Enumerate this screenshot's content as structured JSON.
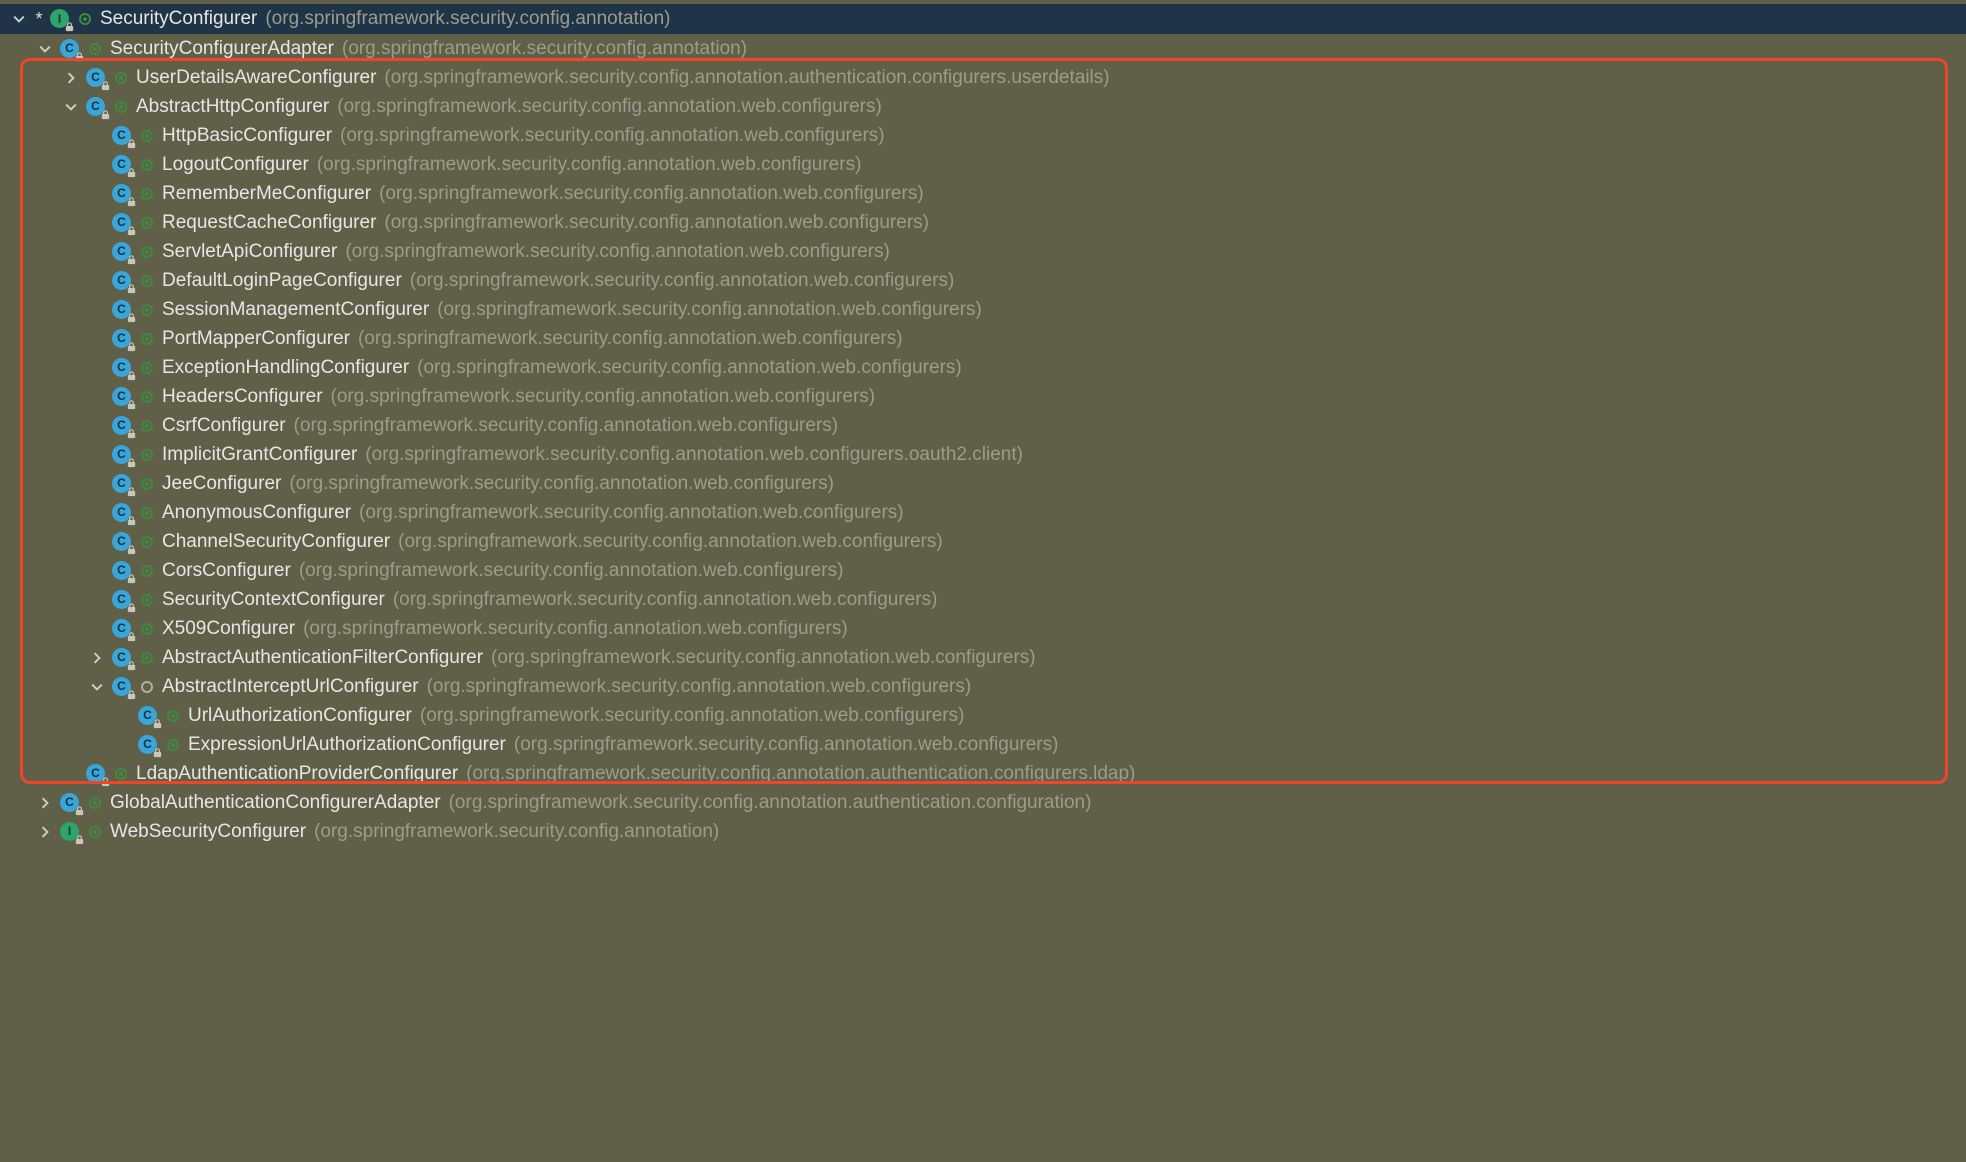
{
  "pkg_annotation": "(org.springframework.security.config.annotation)",
  "pkg_web_conf": "(org.springframework.security.config.annotation.web.configurers)",
  "pkg_userdetails": "(org.springframework.security.config.annotation.authentication.configurers.userdetails)",
  "pkg_oauth2": "(org.springframework.security.config.annotation.web.configurers.oauth2.client)",
  "pkg_ldap": "(org.springframework.security.config.annotation.authentication.configurers.ldap)",
  "pkg_auth_conf": "(org.springframework.security.config.annotation.authentication.configuration)",
  "nodes": [
    {
      "indent": 0,
      "arrow": "down",
      "star": true,
      "icon": "interface",
      "vis": "public",
      "name": "SecurityConfigurer",
      "pkgref": "pkg_annotation",
      "root": true
    },
    {
      "indent": 1,
      "arrow": "down",
      "star": false,
      "icon": "class",
      "vis": "public",
      "name": "SecurityConfigurerAdapter",
      "pkgref": "pkg_annotation"
    },
    {
      "indent": 2,
      "arrow": "right",
      "star": false,
      "icon": "class",
      "vis": "public",
      "name": "UserDetailsAwareConfigurer",
      "pkgref": "pkg_userdetails"
    },
    {
      "indent": 2,
      "arrow": "down",
      "star": false,
      "icon": "class",
      "vis": "public",
      "name": "AbstractHttpConfigurer",
      "pkgref": "pkg_web_conf"
    },
    {
      "indent": 3,
      "arrow": "none",
      "star": false,
      "icon": "class",
      "vis": "public",
      "name": "HttpBasicConfigurer",
      "pkgref": "pkg_web_conf"
    },
    {
      "indent": 3,
      "arrow": "none",
      "star": false,
      "icon": "class",
      "vis": "public",
      "name": "LogoutConfigurer",
      "pkgref": "pkg_web_conf"
    },
    {
      "indent": 3,
      "arrow": "none",
      "star": false,
      "icon": "class",
      "vis": "public",
      "name": "RememberMeConfigurer",
      "pkgref": "pkg_web_conf"
    },
    {
      "indent": 3,
      "arrow": "none",
      "star": false,
      "icon": "class",
      "vis": "public",
      "name": "RequestCacheConfigurer",
      "pkgref": "pkg_web_conf"
    },
    {
      "indent": 3,
      "arrow": "none",
      "star": false,
      "icon": "class",
      "vis": "public",
      "name": "ServletApiConfigurer",
      "pkgref": "pkg_web_conf"
    },
    {
      "indent": 3,
      "arrow": "none",
      "star": false,
      "icon": "class",
      "vis": "public",
      "name": "DefaultLoginPageConfigurer",
      "pkgref": "pkg_web_conf"
    },
    {
      "indent": 3,
      "arrow": "none",
      "star": false,
      "icon": "class",
      "vis": "public",
      "name": "SessionManagementConfigurer",
      "pkgref": "pkg_web_conf"
    },
    {
      "indent": 3,
      "arrow": "none",
      "star": false,
      "icon": "class",
      "vis": "public",
      "name": "PortMapperConfigurer",
      "pkgref": "pkg_web_conf"
    },
    {
      "indent": 3,
      "arrow": "none",
      "star": false,
      "icon": "class",
      "vis": "public",
      "name": "ExceptionHandlingConfigurer",
      "pkgref": "pkg_web_conf"
    },
    {
      "indent": 3,
      "arrow": "none",
      "star": false,
      "icon": "class",
      "vis": "public",
      "name": "HeadersConfigurer",
      "pkgref": "pkg_web_conf"
    },
    {
      "indent": 3,
      "arrow": "none",
      "star": false,
      "icon": "class",
      "vis": "public",
      "name": "CsrfConfigurer",
      "pkgref": "pkg_web_conf"
    },
    {
      "indent": 3,
      "arrow": "none",
      "star": false,
      "icon": "class",
      "vis": "public",
      "name": "ImplicitGrantConfigurer",
      "pkgref": "pkg_oauth2"
    },
    {
      "indent": 3,
      "arrow": "none",
      "star": false,
      "icon": "class",
      "vis": "public",
      "name": "JeeConfigurer",
      "pkgref": "pkg_web_conf"
    },
    {
      "indent": 3,
      "arrow": "none",
      "star": false,
      "icon": "class",
      "vis": "public",
      "name": "AnonymousConfigurer",
      "pkgref": "pkg_web_conf"
    },
    {
      "indent": 3,
      "arrow": "none",
      "star": false,
      "icon": "class",
      "vis": "public",
      "name": "ChannelSecurityConfigurer",
      "pkgref": "pkg_web_conf"
    },
    {
      "indent": 3,
      "arrow": "none",
      "star": false,
      "icon": "class",
      "vis": "public",
      "name": "CorsConfigurer",
      "pkgref": "pkg_web_conf"
    },
    {
      "indent": 3,
      "arrow": "none",
      "star": false,
      "icon": "class",
      "vis": "public",
      "name": "SecurityContextConfigurer",
      "pkgref": "pkg_web_conf"
    },
    {
      "indent": 3,
      "arrow": "none",
      "star": false,
      "icon": "class",
      "vis": "public",
      "name": "X509Configurer",
      "pkgref": "pkg_web_conf"
    },
    {
      "indent": 3,
      "arrow": "right",
      "star": false,
      "icon": "class",
      "vis": "public",
      "name": "AbstractAuthenticationFilterConfigurer",
      "pkgref": "pkg_web_conf"
    },
    {
      "indent": 3,
      "arrow": "down",
      "star": false,
      "icon": "class",
      "vis": "package",
      "name": "AbstractInterceptUrlConfigurer",
      "pkgref": "pkg_web_conf"
    },
    {
      "indent": 4,
      "arrow": "none",
      "star": false,
      "icon": "class",
      "vis": "public",
      "name": "UrlAuthorizationConfigurer",
      "pkgref": "pkg_web_conf"
    },
    {
      "indent": 4,
      "arrow": "none",
      "star": false,
      "icon": "class",
      "vis": "public",
      "name": "ExpressionUrlAuthorizationConfigurer",
      "pkgref": "pkg_web_conf"
    },
    {
      "indent": 2,
      "arrow": "none",
      "star": false,
      "icon": "class",
      "vis": "public",
      "name": "LdapAuthenticationProviderConfigurer",
      "pkgref": "pkg_ldap"
    },
    {
      "indent": 1,
      "arrow": "right",
      "star": false,
      "icon": "class",
      "vis": "public",
      "name": "GlobalAuthenticationConfigurerAdapter",
      "pkgref": "pkg_auth_conf"
    },
    {
      "indent": 1,
      "arrow": "right",
      "star": false,
      "icon": "interface",
      "vis": "public",
      "name": "WebSecurityConfigurer",
      "pkgref": "pkg_annotation"
    }
  ]
}
